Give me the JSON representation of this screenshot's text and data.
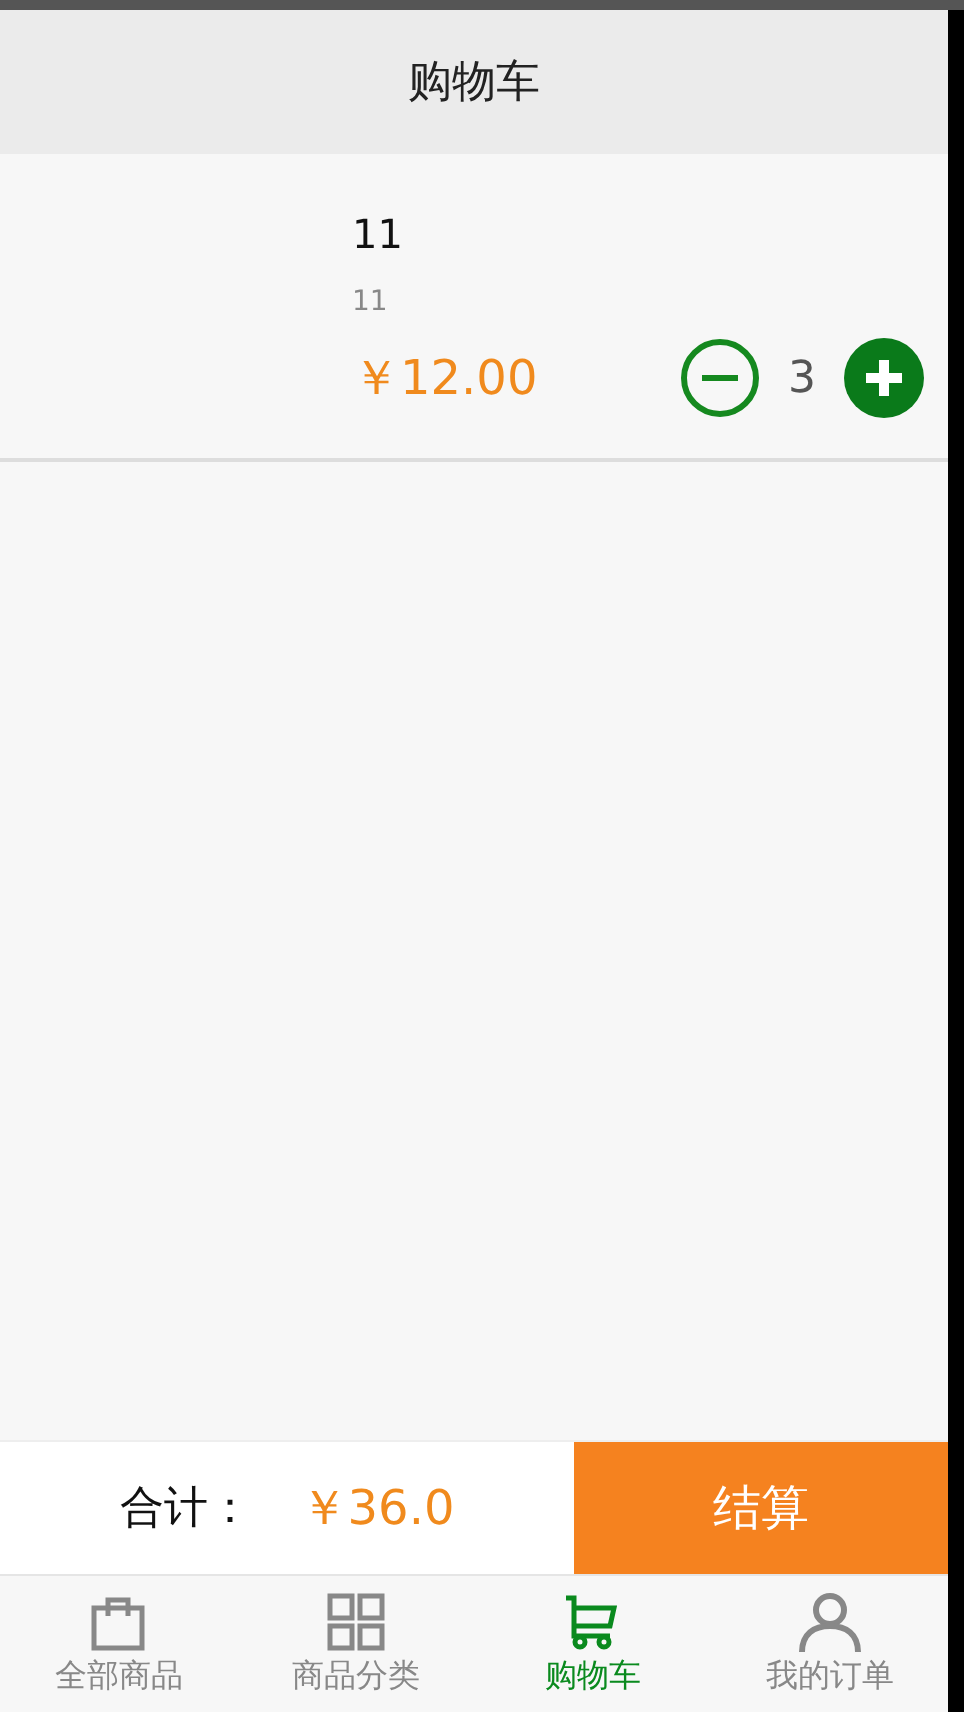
{
  "title": "购物车",
  "items": [
    {
      "name": "11",
      "description": "11",
      "price": "￥12.00",
      "quantity": "3"
    }
  ],
  "footer": {
    "total_label": "合计：",
    "total": "￥36.0",
    "checkout": "结算"
  },
  "tabs": [
    {
      "label": "全部商品",
      "kind": "bag",
      "selected": false
    },
    {
      "label": "商品分类",
      "kind": "grid",
      "selected": false
    },
    {
      "label": "购物车",
      "kind": "cart",
      "selected": true
    },
    {
      "label": "我的订单",
      "kind": "person",
      "selected": false
    }
  ]
}
